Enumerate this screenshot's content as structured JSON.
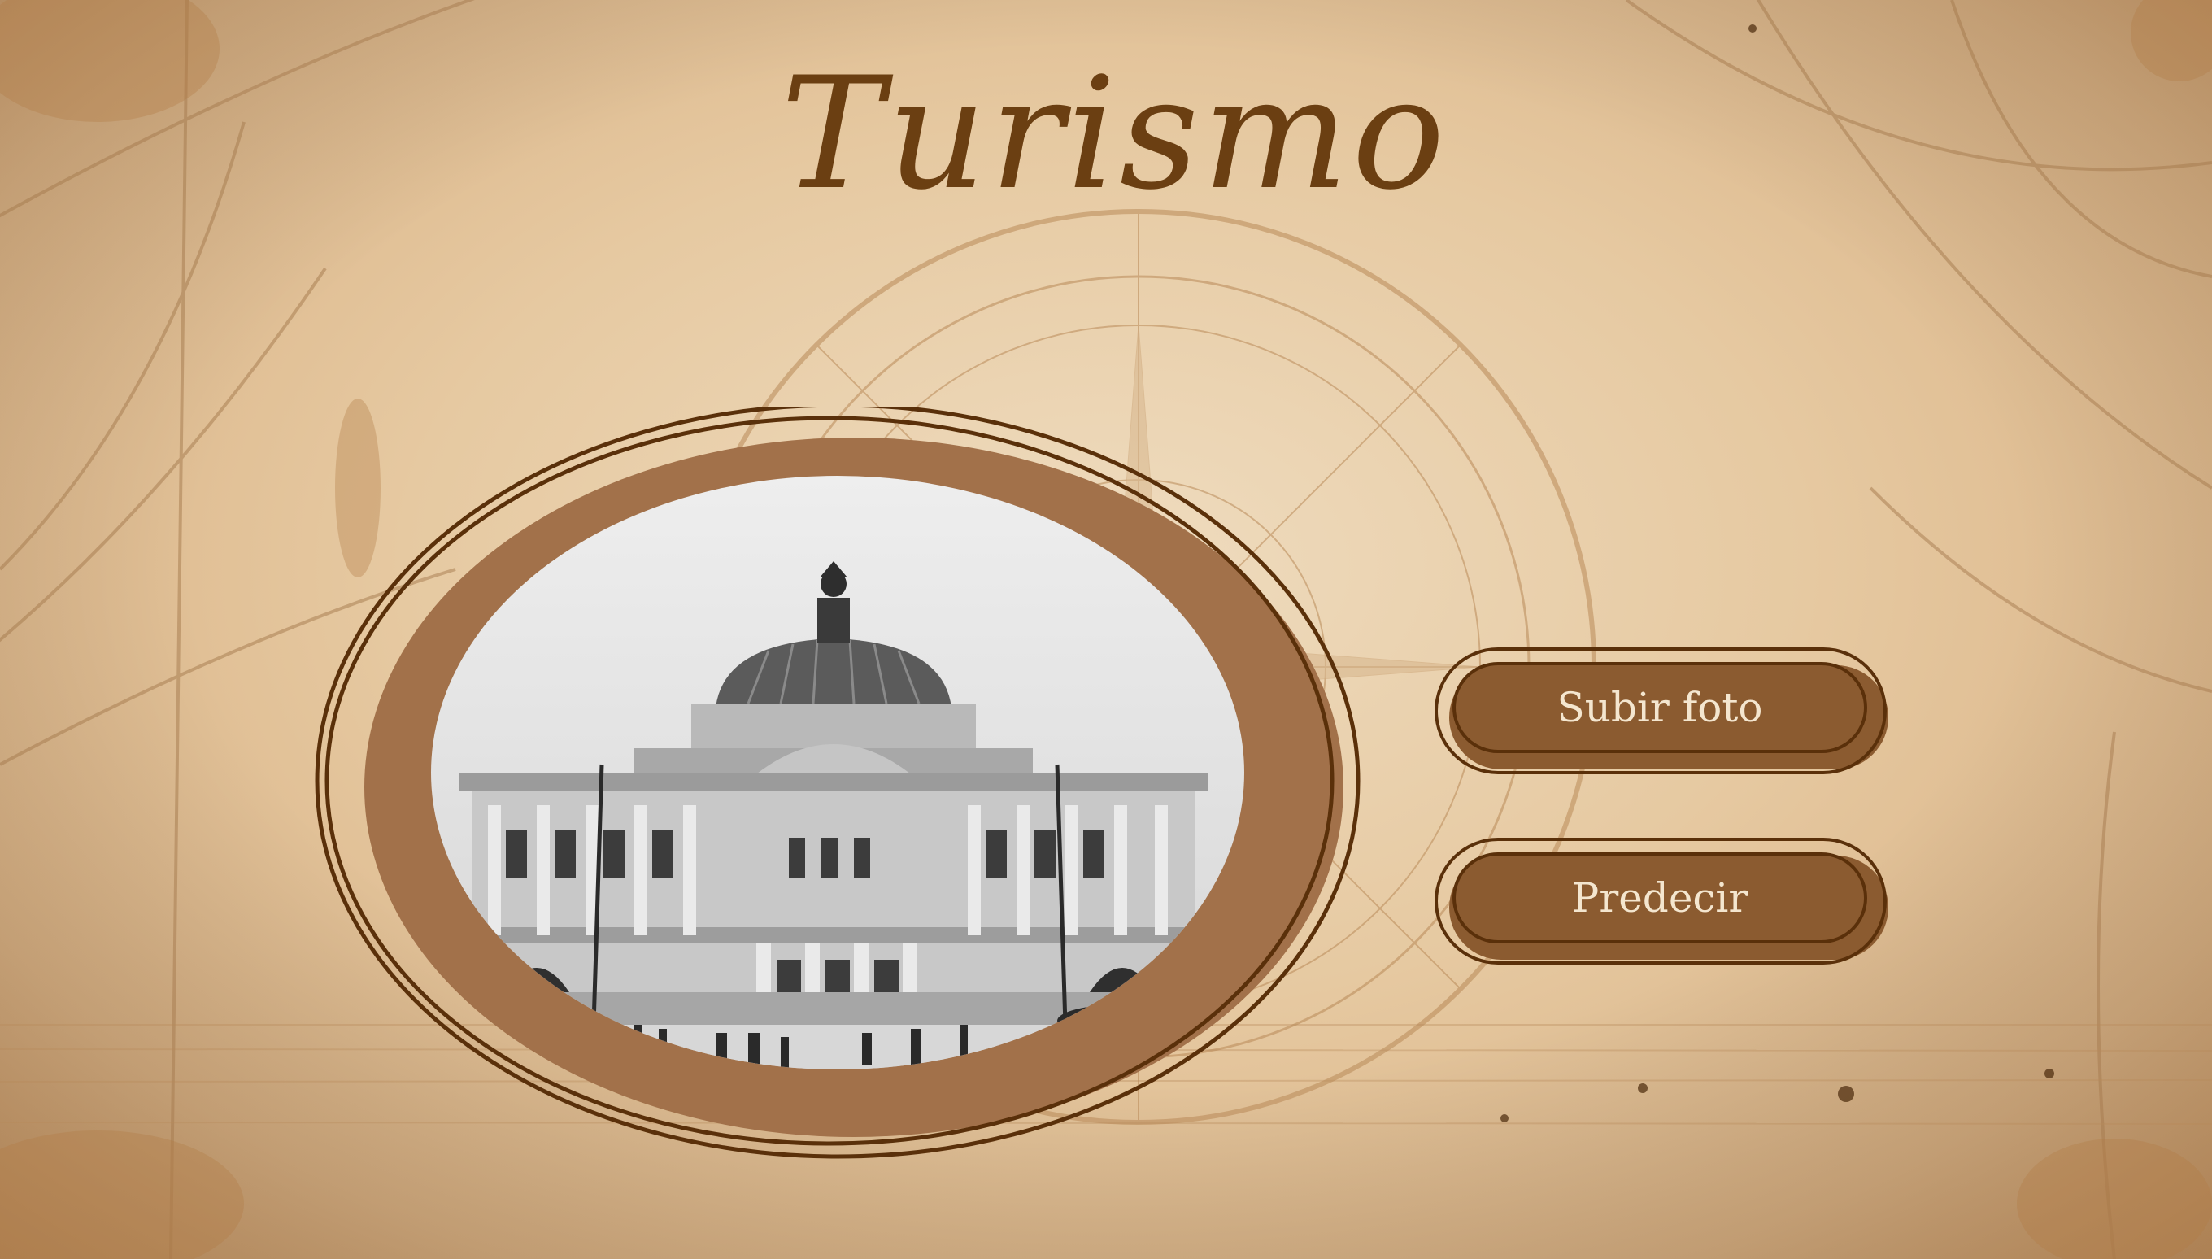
{
  "app": {
    "title": "Turismo"
  },
  "actions": {
    "upload_label": "Subir foto",
    "predict_label": "Predecir"
  },
  "colors": {
    "accent": "#8b5b30",
    "accent_dark": "#5a300a",
    "button_text": "#f4e6cf",
    "frame": "#a2714a",
    "background": "#e6c9a1"
  },
  "images": {
    "preview_alt": "Palacio de Bellas Artes"
  },
  "icons": {
    "compass": "compass-rose-icon"
  }
}
